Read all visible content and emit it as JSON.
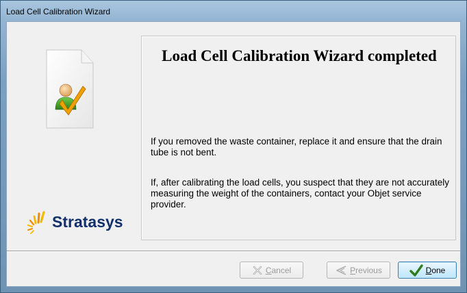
{
  "window": {
    "title": "Load Cell Calibration Wizard"
  },
  "sidebar": {
    "icon": "document-user-checkmark-icon",
    "logo_text": "Stratasys"
  },
  "content": {
    "heading": "Load Cell Calibration Wizard completed",
    "paragraph1": "If you removed the waste container, replace it and ensure that the drain tube is not bent.",
    "paragraph2": "If, after calibrating the load cells, you suspect that they are not accurately measuring the weight of the containers, contact your Objet service provider."
  },
  "buttons": {
    "cancel": {
      "label_underlined": "C",
      "label_rest": "ancel",
      "enabled": false,
      "icon": "x-mark-icon"
    },
    "previous": {
      "label_underlined": "P",
      "label_rest": "revious",
      "enabled": false,
      "icon": "back-arrow-icon"
    },
    "done": {
      "label_underlined": "D",
      "label_rest": "one",
      "enabled": true,
      "icon": "checkmark-icon"
    }
  },
  "colors": {
    "logo_text": "#12316c",
    "checkmark": "#2f7d1a",
    "accent_orange": "#f0a000"
  }
}
